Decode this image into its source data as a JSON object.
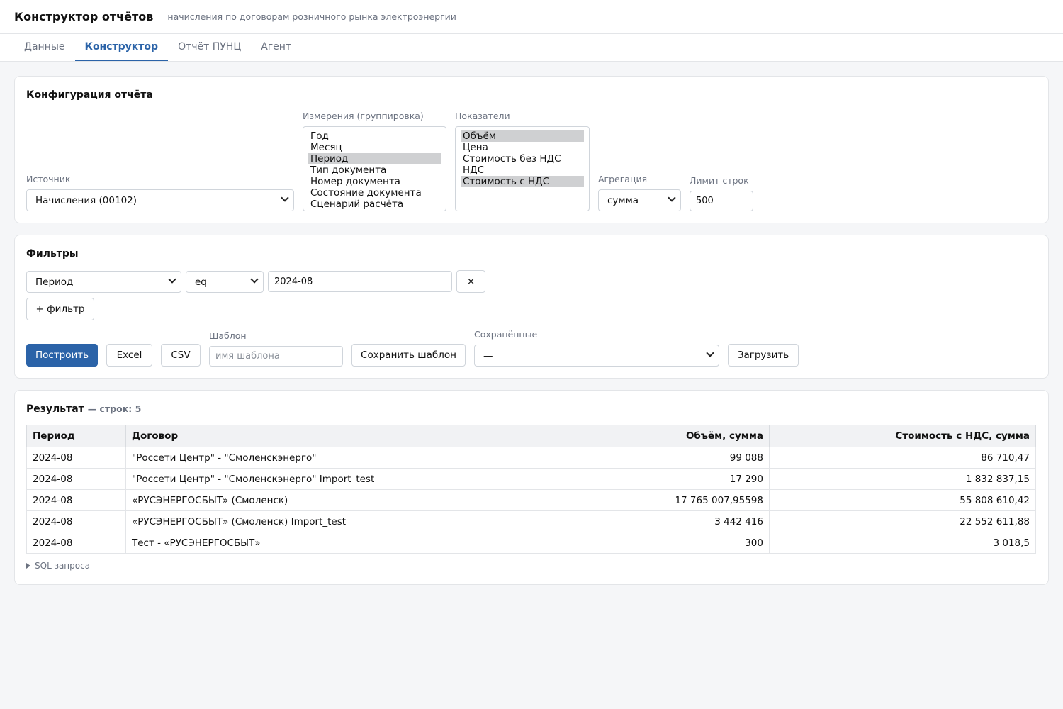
{
  "header": {
    "title": "Конструктор отчётов",
    "subtitle": "начисления по договорам розничного рынка электроэнергии"
  },
  "tabs": [
    {
      "label": "Данные",
      "active": false
    },
    {
      "label": "Конструктор",
      "active": true
    },
    {
      "label": "Отчёт ПУНЦ",
      "active": false
    },
    {
      "label": "Агент",
      "active": false
    }
  ],
  "config": {
    "title": "Конфигурация отчёта",
    "source": {
      "label": "Источник",
      "value": "Начисления (00102)"
    },
    "dimensions": {
      "label": "Измерения (группировка)",
      "options": [
        {
          "label": "Год",
          "selected": false
        },
        {
          "label": "Месяц",
          "selected": false
        },
        {
          "label": "Период",
          "selected": true
        },
        {
          "label": "Тип документа",
          "selected": false
        },
        {
          "label": "Номер документа",
          "selected": false
        },
        {
          "label": "Состояние документа",
          "selected": false
        },
        {
          "label": "Сценарий расчёта",
          "selected": false
        }
      ]
    },
    "metrics": {
      "label": "Показатели",
      "options": [
        {
          "label": "Объём",
          "selected": true
        },
        {
          "label": "Цена",
          "selected": false
        },
        {
          "label": "Стоимость без НДС",
          "selected": false
        },
        {
          "label": "НДС",
          "selected": false
        },
        {
          "label": "Стоимость с НДС",
          "selected": true
        }
      ]
    },
    "aggregation": {
      "label": "Агрегация",
      "value": "сумма"
    },
    "limit": {
      "label": "Лимит строк",
      "value": "500"
    }
  },
  "filters": {
    "title": "Фильтры",
    "rows": [
      {
        "field": "Период",
        "op": "eq",
        "value": "2024-08",
        "remove": "×"
      }
    ],
    "add_label": "+ фильтр",
    "build_label": "Построить",
    "excel_label": "Excel",
    "csv_label": "CSV",
    "template": {
      "label": "Шаблон",
      "placeholder": "имя шаблона",
      "value": ""
    },
    "save_label": "Сохранить шаблон",
    "saved": {
      "label": "Сохранённые",
      "value": "—"
    },
    "load_label": "Загрузить"
  },
  "result": {
    "title": "Результат",
    "count_text": "— строк: 5",
    "columns": [
      "Период",
      "Договор",
      "Объём, сумма",
      "Стоимость с НДС, сумма"
    ],
    "rows": [
      [
        "2024-08",
        "\"Россети Центр\" - \"Смоленскэнерго\"",
        "99 088",
        "86 710,47"
      ],
      [
        "2024-08",
        "\"Россети Центр\" - \"Смоленскэнерго\" Import_test",
        "17 290",
        "1 832 837,15"
      ],
      [
        "2024-08",
        "«РУСЭНЕРГОСБЫТ» (Смоленск)",
        "17 765 007,95598",
        "55 808 610,42"
      ],
      [
        "2024-08",
        "«РУСЭНЕРГОСБЫТ» (Смоленск) Import_test",
        "3 442 416",
        "22 552 611,88"
      ],
      [
        "2024-08",
        "Тест - «РУСЭНЕРГОСБЫТ»",
        "300",
        "3 018,5"
      ]
    ],
    "sql_toggle": "SQL запроса"
  }
}
